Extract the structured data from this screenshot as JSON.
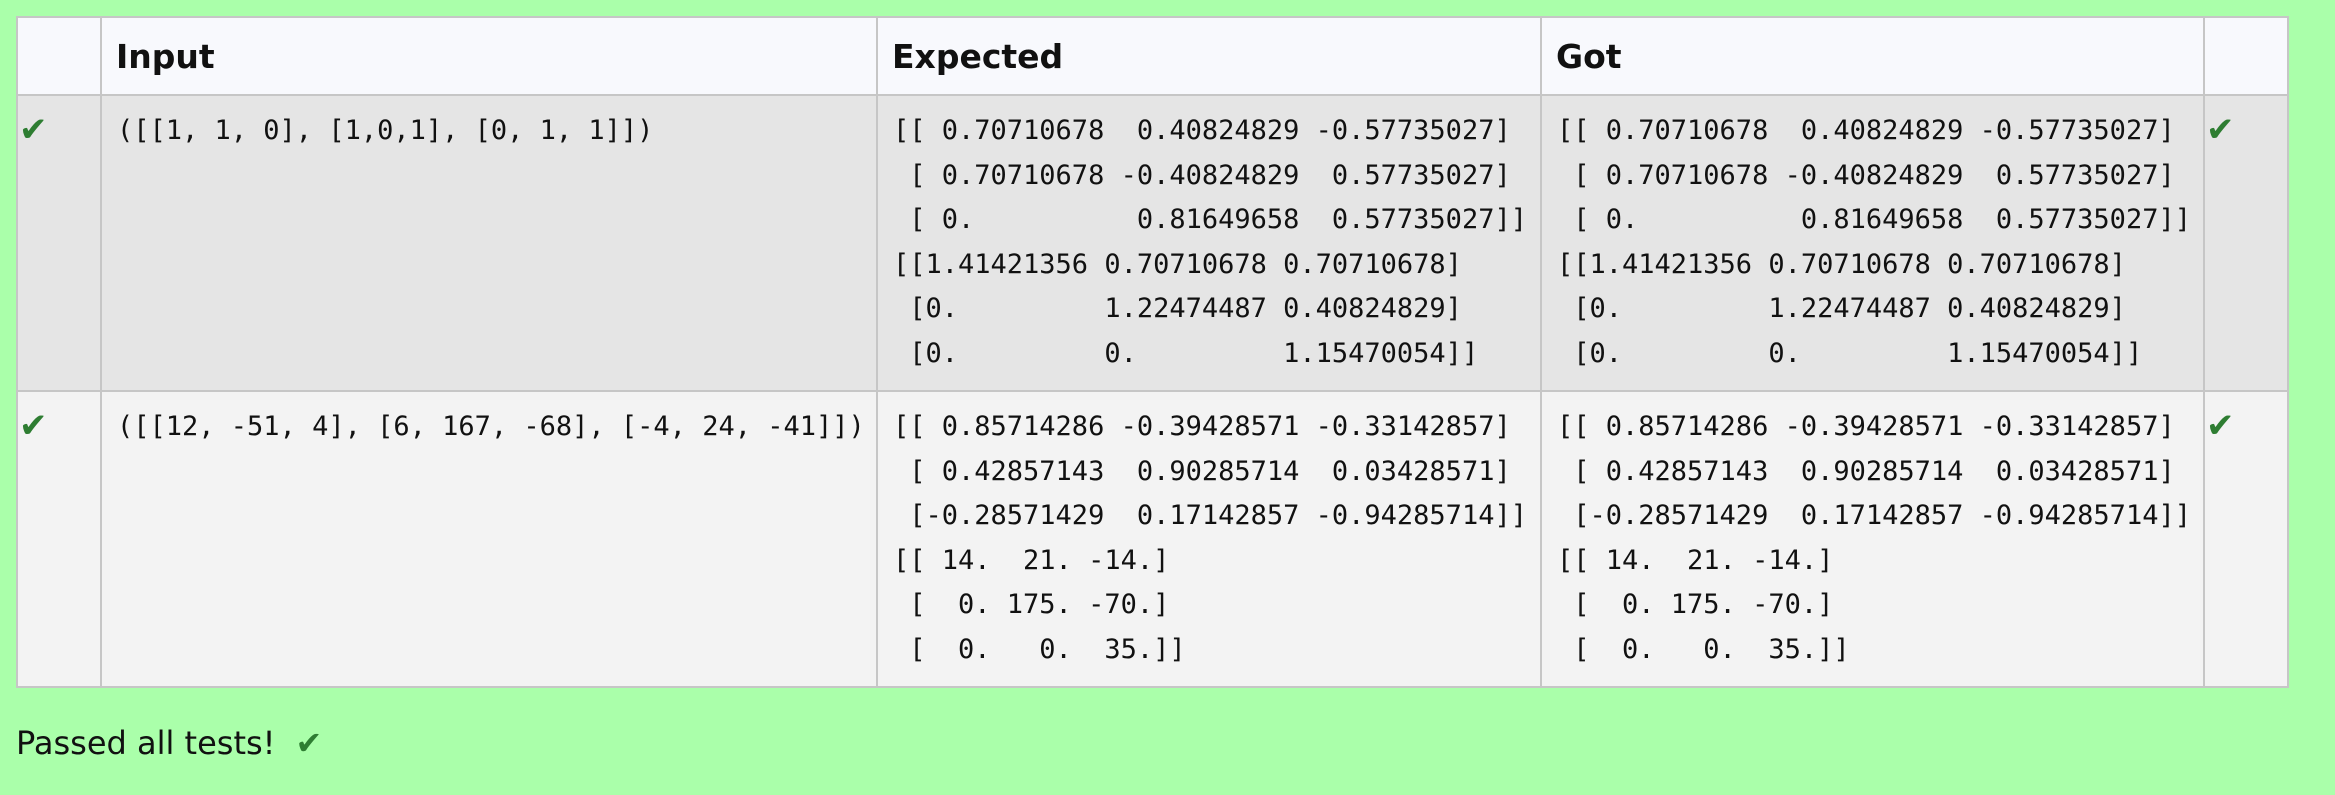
{
  "table": {
    "headers": [
      "",
      "Input",
      "Expected",
      "Got",
      ""
    ],
    "rows": [
      {
        "status": "passed",
        "input": "([[1, 1, 0], [1,0,1], [0, 1, 1]])",
        "expected": "[[ 0.70710678  0.40824829 -0.57735027]\n [ 0.70710678 -0.40824829  0.57735027]\n [ 0.          0.81649658  0.57735027]]\n[[1.41421356 0.70710678 0.70710678]\n [0.         1.22474487 0.40824829]\n [0.         0.         1.15470054]]",
        "got": "[[ 0.70710678  0.40824829 -0.57735027]\n [ 0.70710678 -0.40824829  0.57735027]\n [ 0.          0.81649658  0.57735027]]\n[[1.41421356 0.70710678 0.70710678]\n [0.         1.22474487 0.40824829]\n [0.         0.         1.15470054]]"
      },
      {
        "status": "passed",
        "input": "([[12, -51, 4], [6, 167, -68], [-4, 24, -41]])",
        "expected": "[[ 0.85714286 -0.39428571 -0.33142857]\n [ 0.42857143  0.90285714  0.03428571]\n [-0.28571429  0.17142857 -0.94285714]]\n[[ 14.  21. -14.]\n [  0. 175. -70.]\n [  0.   0.  35.]]",
        "got": "[[ 0.85714286 -0.39428571 -0.33142857]\n [ 0.42857143  0.90285714  0.03428571]\n [-0.28571429  0.17142857 -0.94285714]]\n[[ 14.  21. -14.]\n [  0. 175. -70.]\n [  0.   0.  35.]]"
      }
    ]
  },
  "summary": {
    "text": "Passed all tests!"
  },
  "icons": {
    "check": "check-icon",
    "check_glyph": "✔",
    "check_color": "#2e7d32"
  },
  "colors": {
    "page_background": "#aaffaa",
    "header_background": "#f8f9fd",
    "row_odd_background": "#e5e5e5",
    "row_even_background": "#f3f3f3"
  }
}
